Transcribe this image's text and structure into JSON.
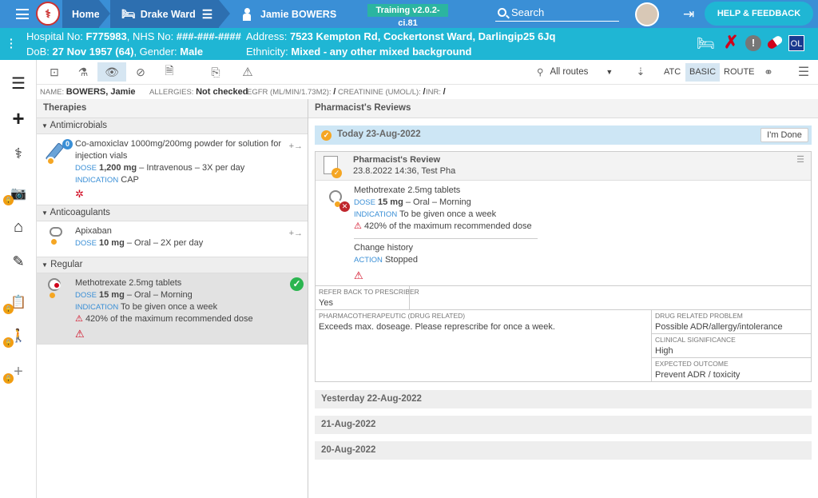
{
  "topbar": {
    "home": "Home",
    "ward": "Drake Ward",
    "patient": "Jamie BOWERS",
    "version": "Training v2.0.2-ci.81",
    "search_placeholder": "Search",
    "help": "HELP & FEEDBACK"
  },
  "patient": {
    "hospital_label": "Hospital No:",
    "hospital_no": "F775983",
    "nhs_label": ", NHS No:",
    "nhs_no": "###-###-####",
    "address_label": "Address:",
    "address": "7523 Kempton Rd, Cockertonst Ward, Darlingip25 6Jq",
    "dob_label": "DoB:",
    "dob": "27 Nov 1957 (64)",
    "gender_label": ", Gender:",
    "gender": "Male",
    "ethnicity_label": "Ethnicity:",
    "ethnicity": "Mixed - any other mixed background",
    "badge": "OL"
  },
  "toolbar": {
    "routes": "All routes",
    "atc": "ATC",
    "basic": "BASIC",
    "route": "ROUTE"
  },
  "info": {
    "name_label": "NAME:",
    "name": "BOWERS, Jamie",
    "allergies_label": "ALLERGIES:",
    "allergies": "Not checked",
    "egfr_label": "EGFR (ML/MIN/1.73M2):",
    "egfr": "/",
    "creat_label": "CREATININE (UMOL/L):",
    "creat": "/",
    "inr_label": "INR:",
    "inr": "/"
  },
  "therapies": {
    "title": "Therapies",
    "groups": [
      {
        "name": "Antimicrobials"
      },
      {
        "name": "Anticoagulants"
      },
      {
        "name": "Regular"
      }
    ],
    "drugs": [
      {
        "name": "Co-amoxiclav 1000mg/200mg powder for solution for injection vials",
        "dose_label": "DOSE",
        "dose": "1,200 mg",
        "route": " – Intravenous – 3X per day",
        "ind_label": "INDICATION",
        "indication": "CAP",
        "badge": "0"
      },
      {
        "name": "Apixaban",
        "dose_label": "DOSE",
        "dose": "10 mg",
        "route": " – Oral – 2X per day"
      },
      {
        "name": "Methotrexate 2.5mg tablets",
        "dose_label": "DOSE",
        "dose": "15 mg",
        "route": " – Oral – Morning",
        "ind_label": "INDICATION",
        "indication": "To be given once a week",
        "warning": "420% of the maximum recommended dose"
      }
    ]
  },
  "reviews": {
    "title": "Pharmacist's Reviews",
    "today": "Today 23-Aug-2022",
    "done": "I'm Done",
    "card_title": "Pharmacist's Review",
    "card_sub": "23.8.2022 14:36, Test Pha",
    "drug": "Methotrexate 2.5mg tablets",
    "dose_label": "DOSE",
    "dose": "15 mg",
    "route": " – Oral – Morning",
    "ind_label": "INDICATION",
    "indication": "To be given once a week",
    "warning": "420% of the maximum recommended dose",
    "change_history": "Change history",
    "action_label": "ACTION",
    "action": "Stopped",
    "refer_label": "REFER BACK TO PRESCRIBER",
    "refer": "Yes",
    "pharm_label": "PHARMACOTHERAPEUTIC (DRUG RELATED)",
    "pharm": "Exceeds max. doseage. Please represcribe for once a week.",
    "drp_label": "DRUG RELATED PROBLEM",
    "drp": "Possible ADR/allergy/intolerance",
    "sig_label": "CLINICAL SIGNIFICANCE",
    "sig": "High",
    "outcome_label": "EXPECTED OUTCOME",
    "outcome": "Prevent ADR / toxicity",
    "days": [
      "Yesterday 22-Aug-2022",
      "21-Aug-2022",
      "20-Aug-2022"
    ]
  }
}
